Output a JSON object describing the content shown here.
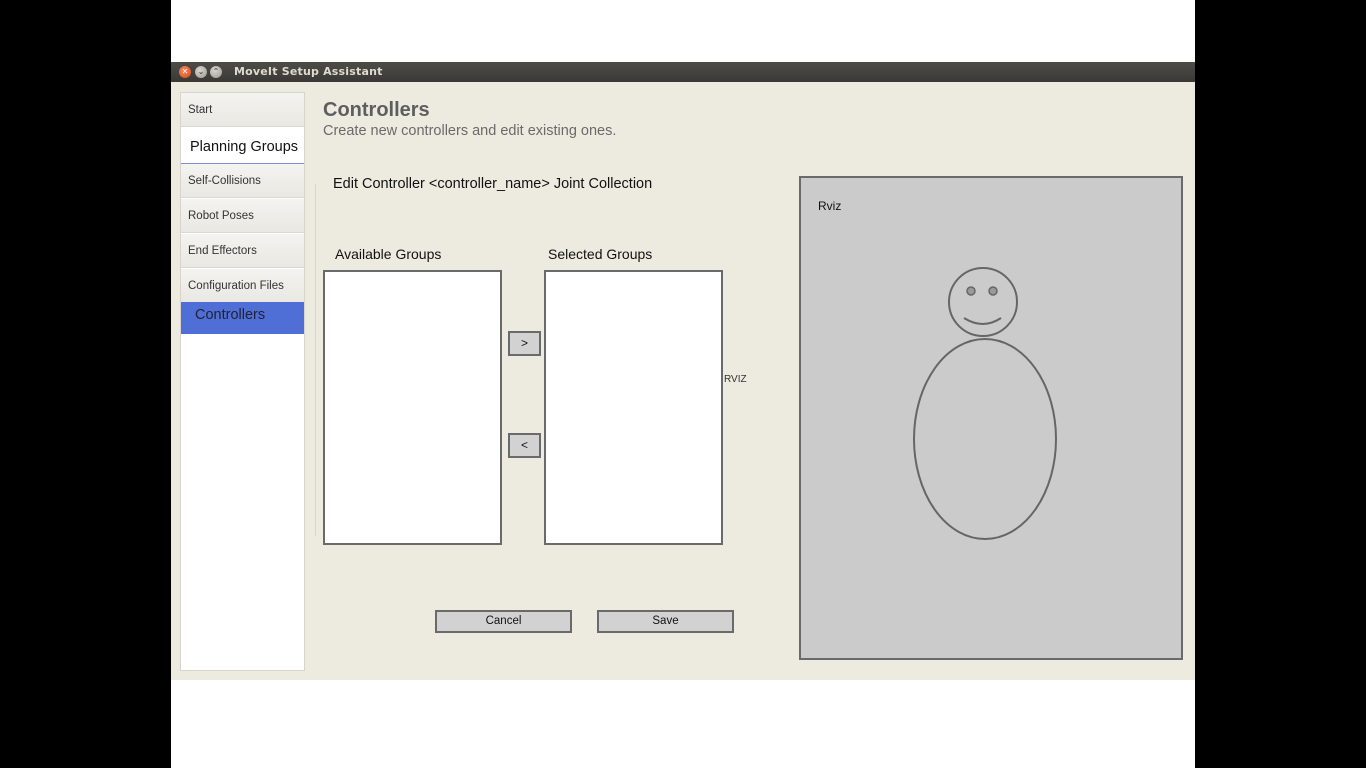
{
  "window": {
    "title": "MoveIt Setup Assistant"
  },
  "sidebar": {
    "items": [
      {
        "label": "Start"
      },
      {
        "label": "Planning Groups"
      },
      {
        "label": "Self-Collisions"
      },
      {
        "label": "Robot Poses"
      },
      {
        "label": "End Effectors"
      },
      {
        "label": "Configuration Files"
      },
      {
        "label": "Controllers",
        "active": true
      }
    ]
  },
  "main": {
    "title": "Controllers",
    "subtitle": "Create new controllers and edit existing ones.",
    "edit_title": "Edit Controller <controller_name> Joint Collection",
    "available_label": "Available Groups",
    "selected_label": "Selected Groups",
    "add_button": ">",
    "remove_button": "<",
    "rviz_placeholder_text": "RVIZ",
    "cancel_button": "Cancel",
    "save_button": "Save"
  },
  "rviz": {
    "label": "Rviz"
  },
  "colors": {
    "accent": "#4f6fd6",
    "panel": "#cbcbcb",
    "window_bg": "#edebe0"
  }
}
